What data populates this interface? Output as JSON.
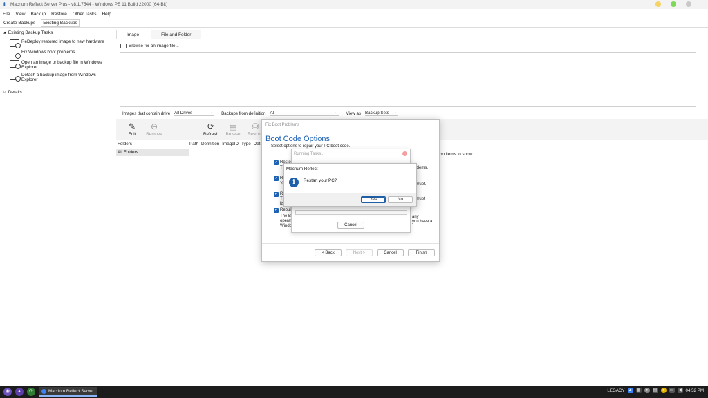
{
  "window": {
    "title": "Macrium Reflect Server Plus - v8.1.7544 - Windows PE 11 Build 22000 (64-Bit)",
    "controls_colors": [
      "#f6d365",
      "#7ed957",
      "#c9c9c9"
    ]
  },
  "menu": [
    "File",
    "View",
    "Backup",
    "Restore",
    "Other Tasks",
    "Help"
  ],
  "subtabs": [
    "Create Backups",
    "Existing Backups"
  ],
  "sidebar": {
    "header": "Existing Backup Tasks",
    "items": [
      {
        "label": "ReDeploy restored image to new hardware"
      },
      {
        "label": "Fix Windows boot problems"
      },
      {
        "label": "Open an image or backup file in Windows Explorer"
      },
      {
        "label": "Detach a backup image from Windows Explorer"
      }
    ],
    "details": "Details"
  },
  "main": {
    "tabs": [
      "Image",
      "File and Folder"
    ],
    "browse_link": "Browse for an image file...",
    "filter": {
      "drives_label": "Images that contain drive",
      "drives_value": "All Drives",
      "definition_label": "Backups from definition",
      "definition_value": "All",
      "view_label": "View as",
      "view_value": "Backup Sets"
    },
    "toolbar": [
      {
        "label": "Edit",
        "icon": "edit-icon",
        "glyph": "✎"
      },
      {
        "label": "Remove",
        "icon": "remove-icon",
        "glyph": "⊖"
      },
      {
        "label": "Refresh",
        "icon": "refresh-icon",
        "glyph": "⟳"
      },
      {
        "label": "Browse",
        "icon": "browse-icon",
        "glyph": "▤"
      },
      {
        "label": "Restore",
        "icon": "restore-icon",
        "glyph": "⛁"
      }
    ],
    "folders_label": "Folders",
    "all_folders": "All Folders",
    "columns": [
      "Path",
      "Definition",
      "ImageID",
      "Type",
      "Date"
    ],
    "no_items": "no items to show"
  },
  "wizard": {
    "title": "Fix Boot Problems",
    "heading": "Boot Code Options",
    "subheading": "Select options to repair your PC boot code.",
    "options": [
      {
        "label": "Restore",
        "desc_left": "Th",
        "desc_right": "roblems."
      },
      {
        "label": "Re",
        "desc_left": "Yo",
        "desc_right": "corrupt."
      },
      {
        "label": "Re",
        "desc_left": "Th\nits",
        "desc_right": "corrupt"
      },
      {
        "label": "Rebuild",
        "desc_left": "The Bo\noperat\nWindo",
        "desc_right": "any\nyou have a"
      }
    ],
    "buttons": {
      "back": "< Back",
      "next": "Next >",
      "cancel": "Cancel",
      "finish": "Finish"
    }
  },
  "running": {
    "title": "Running Tasks...",
    "cancel": "Cancel"
  },
  "msgbox": {
    "title": "Macrium Reflect",
    "icon": "info-icon",
    "text": "Restart your PC?",
    "yes": "Yes",
    "no": "No"
  },
  "taskbar": {
    "app_label": "Macrium Reflect Serve...",
    "tray_text": "LEGACY",
    "clock": "04:52 PM"
  }
}
